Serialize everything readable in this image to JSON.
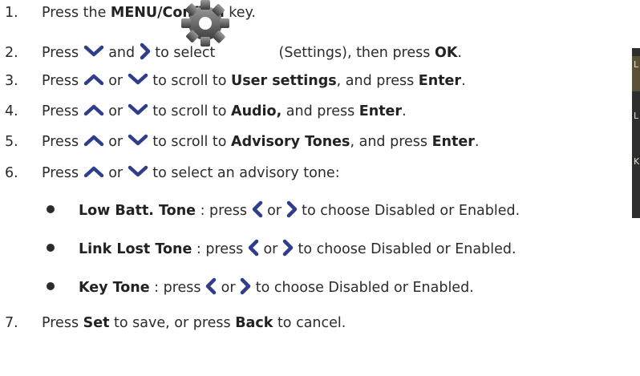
{
  "steps": [
    {
      "num": "1.",
      "pre": "Press the ",
      "bold": "MENU/Confirm",
      "post": " key."
    },
    {
      "num": "2.",
      "pre": "Press ",
      "mid1": " and ",
      "mid2": " to select ",
      "post1": " (Settings), then press ",
      "bold": "OK",
      "post2": "."
    },
    {
      "num": "3.",
      "pre": "Press ",
      "or": " or ",
      "mid": " to scroll to ",
      "bold1": "User settings",
      "mid2": ", and press ",
      "bold2": "Enter",
      "post": "."
    },
    {
      "num": "4.",
      "pre": "Press ",
      "or": " or ",
      "mid": " to scroll to ",
      "bold1": "Audio,",
      "mid2": " and press ",
      "bold2": "Enter",
      "post": "."
    },
    {
      "num": "5.",
      "pre": "Press ",
      "or": " or ",
      "mid": " to scroll to ",
      "bold1": "Advisory Tones",
      "mid2": ", and press ",
      "bold2": "Enter",
      "post": "."
    },
    {
      "num": "6.",
      "pre": "Press ",
      "or": " or ",
      "post": " to select an advisory tone:"
    },
    {
      "num": "7.",
      "pre": "Press ",
      "bold1": "Set",
      "mid": " to save, or press ",
      "bold2": "Back",
      "post": " to cancel."
    }
  ],
  "bullets": [
    {
      "bold": "Low Batt. Tone",
      "pre": " : press ",
      "or": " or ",
      "post": " to  choose Disabled or Enabled."
    },
    {
      "bold": "Link Lost Tone",
      "pre": " : press ",
      "or": " or ",
      "post": " to  choose Disabled or Enabled."
    },
    {
      "bold": "Key Tone",
      "pre": " : press ",
      "or": " or ",
      "post": " to  choose Disabled or Enabled."
    }
  ],
  "device_strip": {
    "chars": [
      "L",
      "L",
      "K"
    ]
  },
  "colors": {
    "text": "#2b2b2b",
    "strip": "#2e2e2e",
    "highlight": "#5a5238"
  },
  "icons": [
    "chevron-down-icon",
    "chevron-right-icon",
    "chevron-up-icon",
    "chevron-left-icon",
    "gear-icon"
  ]
}
